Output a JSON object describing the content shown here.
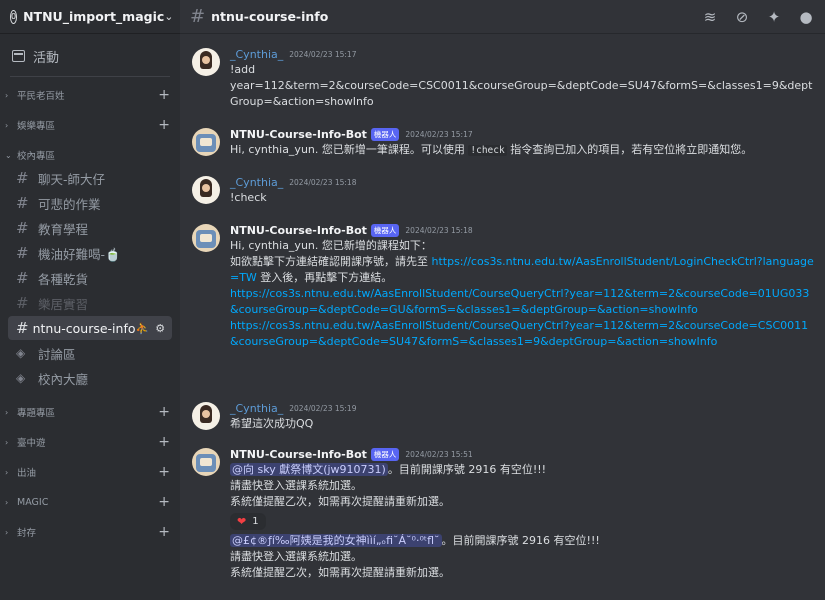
{
  "server": {
    "badge": "0",
    "name": "NTNU_import_magic"
  },
  "sidebar": {
    "events_label": "活動",
    "categories": {
      "c1": "平民老百姓",
      "c2": "娛樂專區",
      "c3": "校內專區",
      "c4": "專題專區",
      "c5": "臺中遊",
      "c6": "出油",
      "c7": "MAGIC",
      "c8": "封存"
    },
    "channels": {
      "chat": "聊天-師大仔",
      "homework": "可悲的作業",
      "edu": "教育學程",
      "food": "機油好難喝-🍵",
      "misc": "各種乾貨",
      "music": "樂居實習",
      "course": "ntnu-course-info",
      "forum": "討論區",
      "hall": "校內大廳"
    }
  },
  "topbar": {
    "channel_name": "ntnu-course-info"
  },
  "messages": {
    "m1": {
      "author": "_Cynthia_",
      "time": "2024/02/23 15:17",
      "lines": [
        "!add",
        "year=112&term=2&courseCode=CSC0011&courseGroup=&deptCode=SU47&formS=&classes1=9&deptGroup=&action=showInfo"
      ]
    },
    "m2": {
      "author": "NTNU-Course-Info-Bot",
      "tag": "機器人",
      "time": "2024/02/23 15:17",
      "pre": "Hi, cynthia_yun. 您已新增一筆課程。可以使用 ",
      "code": "!check",
      "post": " 指令查詢已加入的項目，若有空位將立即通知您。"
    },
    "m3": {
      "author": "_Cynthia_",
      "time": "2024/02/23 15:18",
      "text": "!check"
    },
    "m4": {
      "author": "NTNU-Course-Info-Bot",
      "tag": "機器人",
      "time": "2024/02/23 15:18",
      "l1": "Hi, cynthia_yun. 您已新增的課程如下：",
      "l2": "如欲點擊下方連結確認開課序號，請先至 ",
      "link1": "https://cos3s.ntnu.edu.tw/AasEnrollStudent/LoginCheckCtrl?language=TW",
      "l3": " 登入後，再點擊下方連結。",
      "link2": "https://cos3s.ntnu.edu.tw/AasEnrollStudent/CourseQueryCtrl?year=112&term=2&courseCode=01UG033&courseGroup=&deptCode=GU&formS=&classes1=&deptGroup=&action=showInfo",
      "link3": "https://cos3s.ntnu.edu.tw/AasEnrollStudent/CourseQueryCtrl?year=112&term=2&courseCode=CSC0011&courseGroup=&deptCode=SU47&formS=&classes1=9&deptGroup=&action=showInfo"
    },
    "m5": {
      "author": "_Cynthia_",
      "time": "2024/02/23 15:19",
      "text": "希望這次成功QQ"
    },
    "m6": {
      "author": "NTNU-Course-Info-Bot",
      "tag": "機器人",
      "time": "2024/02/23 15:51",
      "mention1": "@向 sky 獻祭博文(jw910731)",
      "a1": "。目前開課序號 2916 有空位!!!",
      "a2": "請盡快登入選課系統加選。",
      "a3": "系統僅提醒乙次，如需再次提醒請重新加選。",
      "reaction_count": "1",
      "mention2": "@£¢®ƒí‰阿姨是我的女神ììí„ₒfi˘Á˘⁰·⁰ᵗfl˘",
      "b1": "。目前開課序號 2916 有空位!!!",
      "b2": "請盡快登入選課系統加選。",
      "b3": "系統僅提醒乙次，如需再次提醒請重新加選。"
    }
  }
}
